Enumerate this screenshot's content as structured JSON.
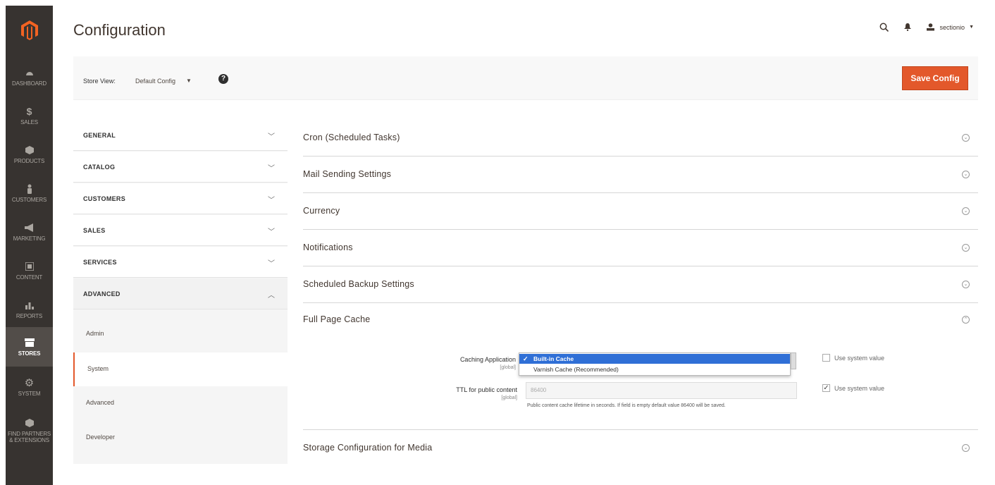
{
  "nav": {
    "items": [
      {
        "label": "DASHBOARD",
        "icon": "dashboard-icon"
      },
      {
        "label": "SALES",
        "icon": "dollar-icon"
      },
      {
        "label": "PRODUCTS",
        "icon": "cube-icon"
      },
      {
        "label": "CUSTOMERS",
        "icon": "person-icon"
      },
      {
        "label": "MARKETING",
        "icon": "megaphone-icon"
      },
      {
        "label": "CONTENT",
        "icon": "content-icon"
      },
      {
        "label": "REPORTS",
        "icon": "bar-chart-icon"
      },
      {
        "label": "STORES",
        "icon": "store-icon"
      },
      {
        "label": "SYSTEM",
        "icon": "gear-icon"
      },
      {
        "label": "FIND PARTNERS & EXTENSIONS",
        "icon": "box-icon"
      }
    ],
    "active_index": 7
  },
  "header": {
    "title": "Configuration",
    "user_name": "sectionio"
  },
  "store_bar": {
    "label": "Store View:",
    "value": "Default Config",
    "help": "?",
    "save_label": "Save Config"
  },
  "tabs": {
    "sections": [
      "GENERAL",
      "CATALOG",
      "CUSTOMERS",
      "SALES",
      "SERVICES",
      "ADVANCED"
    ],
    "advanced_items": [
      "Admin",
      "System",
      "Advanced",
      "Developer"
    ],
    "active_item": "System"
  },
  "main": {
    "sections": [
      "Cron (Scheduled Tasks)",
      "Mail Sending Settings",
      "Currency",
      "Notifications",
      "Scheduled Backup Settings",
      "Full Page Cache",
      "Storage Configuration for Media"
    ],
    "fpc": {
      "caching_label": "Caching Application",
      "caching_scope": "[global]",
      "options": [
        "Built-in Cache",
        "Varnish Cache (Recommended)"
      ],
      "selected_option": "Built-in Cache",
      "ttl_label": "TTL for public content",
      "ttl_scope": "[global]",
      "ttl_value": "86400",
      "ttl_hint": "Public content cache lifetime in seconds. If field is empty default value 86400 will be saved.",
      "use_system_value": "Use system value",
      "caching_use_system": false,
      "ttl_use_system": true
    }
  },
  "colors": {
    "sidebar": "#373330",
    "accent": "#e3582b",
    "selection": "#2f6fd6"
  }
}
